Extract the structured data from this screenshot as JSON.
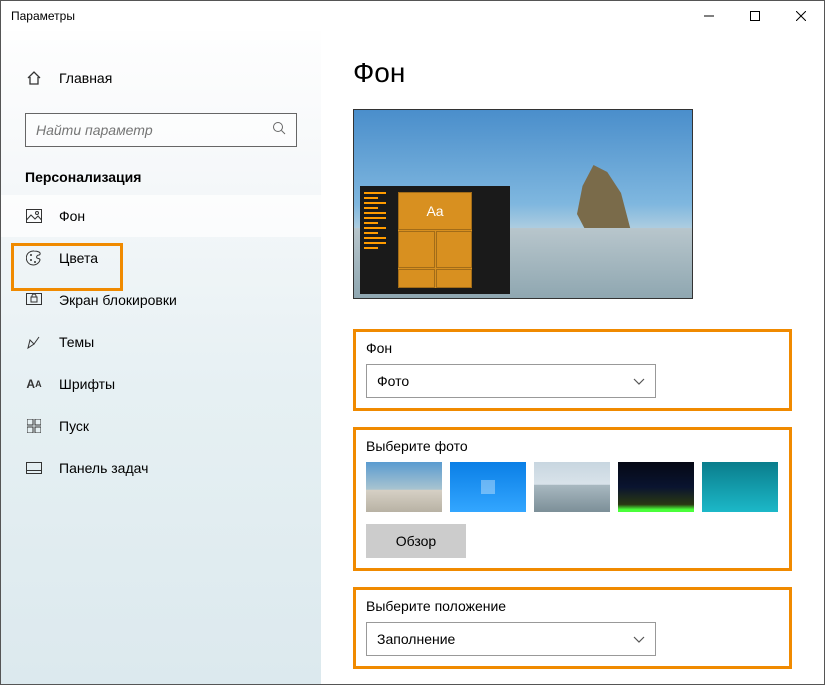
{
  "window": {
    "title": "Параметры"
  },
  "home_label": "Главная",
  "search": {
    "placeholder": "Найти параметр"
  },
  "section": "Персонализация",
  "nav": [
    {
      "label": "Фон"
    },
    {
      "label": "Цвета"
    },
    {
      "label": "Экран блокировки"
    },
    {
      "label": "Темы"
    },
    {
      "label": "Шрифты"
    },
    {
      "label": "Пуск"
    },
    {
      "label": "Панель задач"
    }
  ],
  "page": {
    "heading": "Фон",
    "preview_sample_text": "Aa",
    "bg_label": "Фон",
    "bg_value": "Фото",
    "choose_photo_label": "Выберите фото",
    "browse_label": "Обзор",
    "position_label": "Выберите положение",
    "position_value": "Заполнение"
  }
}
